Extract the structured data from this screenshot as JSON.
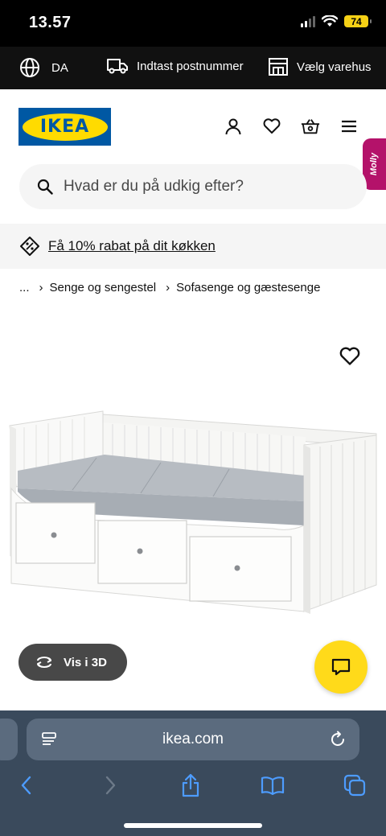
{
  "status_bar": {
    "time": "13.57",
    "battery": "74"
  },
  "utility_bar": {
    "language": "DA",
    "postcode": "Indtast postnummer",
    "store": "Vælg varehus"
  },
  "header": {
    "logo": "IKEA",
    "icons": [
      "user-icon",
      "heart-icon",
      "basket-icon",
      "menu-icon"
    ],
    "molly_tab": "Molly"
  },
  "search": {
    "placeholder": "Hvad er du på udkig efter?"
  },
  "promo": {
    "text": "Få 10% rabat på dit køkken"
  },
  "breadcrumb": {
    "ellipsis": "...",
    "separator": "›",
    "items": [
      "Senge og sengestel",
      "Sofasenge og gæstesenge"
    ]
  },
  "product": {
    "view_3d_label": "Vis i 3D"
  },
  "browser": {
    "url": "ikea.com"
  },
  "colors": {
    "ikea_blue": "#0058a3",
    "ikea_yellow": "#ffdb00",
    "molly_pink": "#b4126a",
    "chat_yellow": "#ffda1a"
  }
}
